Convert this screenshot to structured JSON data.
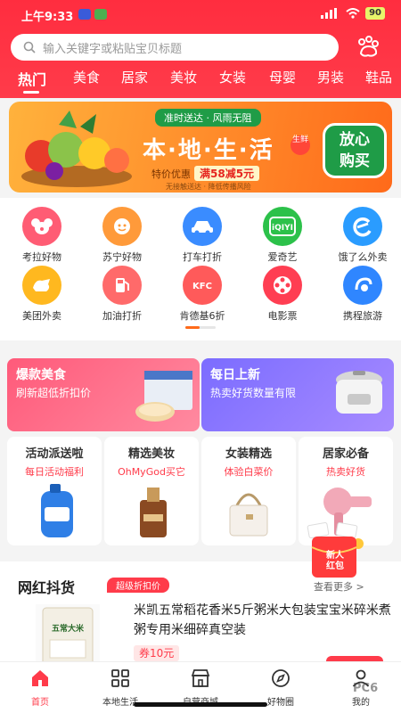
{
  "status": {
    "time": "上午9:33",
    "battery": "90"
  },
  "search": {
    "placeholder": "输入关键字或粘贴宝贝标题"
  },
  "tabs": [
    "热门",
    "美食",
    "居家",
    "美妆",
    "女装",
    "母婴",
    "男装",
    "鞋品"
  ],
  "banner": {
    "tag": "准时送达 · 风雨无阻",
    "title": "本·地·生·活",
    "fresh": "生鲜",
    "promo_label": "特价优惠",
    "promo_value": "满58减5元",
    "note": "无接触送达 · 降低传播风险",
    "badge_line1": "放心",
    "badge_line2": "购买"
  },
  "shortcuts": [
    {
      "label": "考拉好物",
      "icon": "koala-icon",
      "color": "#ff5c74"
    },
    {
      "label": "苏宁好物",
      "icon": "suning-icon",
      "color": "#ff9a3a"
    },
    {
      "label": "打车打折",
      "icon": "taxi-icon",
      "color": "#3a8cff"
    },
    {
      "label": "爱奇艺",
      "icon": "iqiyi-icon",
      "color": "#2cc14a"
    },
    {
      "label": "饿了么外卖",
      "icon": "eleme-icon",
      "color": "#2a9cff"
    },
    {
      "label": "美团外卖",
      "icon": "meituan-icon",
      "color": "#ffb81f"
    },
    {
      "label": "加油打折",
      "icon": "fuel-icon",
      "color": "#ff6a6a"
    },
    {
      "label": "肯德基6折",
      "icon": "kfc-icon",
      "color": "#ff5a5a"
    },
    {
      "label": "电影票",
      "icon": "film-reel-icon",
      "color": "#ff3e52"
    },
    {
      "label": "携程旅游",
      "icon": "ctrip-icon",
      "color": "#2f86ff"
    }
  ],
  "promo_big": [
    {
      "title": "爆款美食",
      "subtitle": "刷新超低折扣价"
    },
    {
      "title": "每日上新",
      "subtitle": "热卖好货数量有限"
    }
  ],
  "small_cards": [
    {
      "title": "活动派送啦",
      "subtitle": "每日活动福利"
    },
    {
      "title": "精选美妆",
      "subtitle": "OhMyGod买它"
    },
    {
      "title": "女装精选",
      "subtitle": "体验白菜价"
    },
    {
      "title": "居家必备",
      "subtitle": "热卖好货"
    }
  ],
  "envelope": {
    "line1": "新人",
    "line2": "红包"
  },
  "hot": {
    "title": "网红抖货",
    "badge": "超级折扣价",
    "more": "查看更多 >",
    "product_title": "米凯五常稻花香米5斤粥米大包装宝宝米碎米煮粥专用米细碎真空装",
    "coupon": "券10元",
    "package_text": "五常大米"
  },
  "nav": [
    {
      "label": "首页",
      "icon": "home-icon"
    },
    {
      "label": "本地生活",
      "icon": "grid-icon"
    },
    {
      "label": "自营商城",
      "icon": "store-icon"
    },
    {
      "label": "好物圈",
      "icon": "compass-icon"
    },
    {
      "label": "我的",
      "icon": "user-icon"
    }
  ],
  "watermark": "PC6"
}
